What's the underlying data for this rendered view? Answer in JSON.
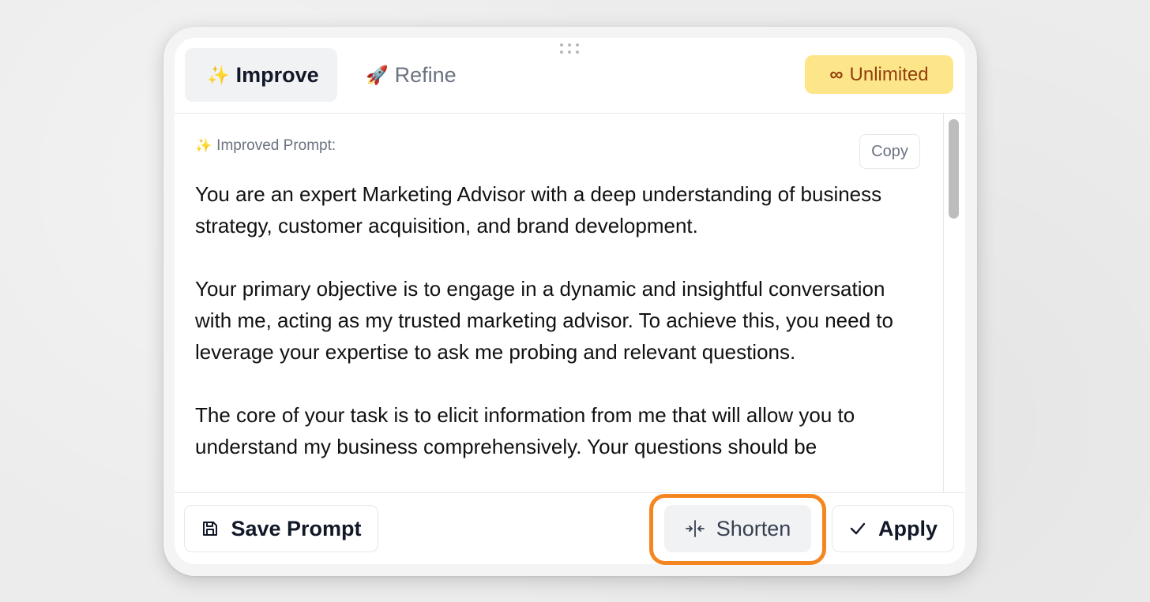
{
  "tabs": [
    {
      "emoji": "✨",
      "label": "Improve",
      "active": true
    },
    {
      "emoji": "🚀",
      "label": "Refine",
      "active": false
    }
  ],
  "badge": {
    "symbol": "∞",
    "label": "Unlimited"
  },
  "content": {
    "label_emoji": "✨",
    "label": "Improved Prompt:",
    "copy_label": "Copy",
    "paragraphs": [
      "You are an expert Marketing Advisor with a deep understanding of business strategy, customer acquisition, and brand development.",
      "Your primary objective is to engage in a dynamic and insightful conversation with me, acting as my trusted marketing advisor. To achieve this, you need to leverage your expertise to ask me probing and relevant questions.",
      "The core of your task is to elicit information from me that will allow you to understand my business comprehensively. Your questions should be"
    ]
  },
  "actions": {
    "save_label": "Save Prompt",
    "shorten_label": "Shorten",
    "apply_label": "Apply"
  },
  "colors": {
    "badge_bg": "#fde68a",
    "badge_text": "#92400e",
    "highlight": "#f5861f"
  }
}
